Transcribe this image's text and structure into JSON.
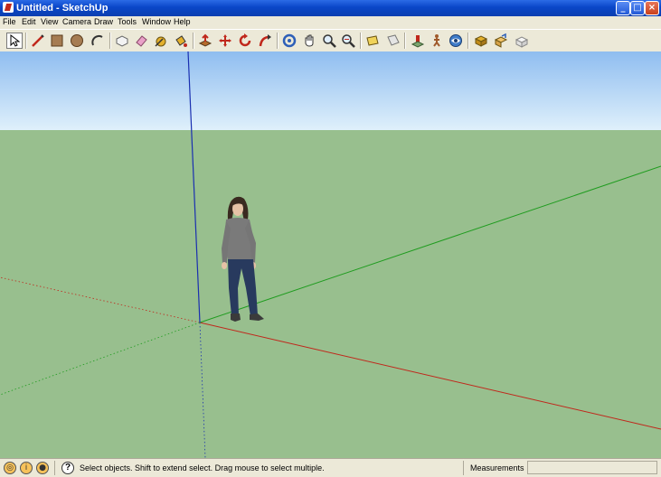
{
  "window": {
    "title": "Untitled - SketchUp",
    "minimize": "_",
    "maximize": "□",
    "close": "×"
  },
  "menu": [
    "File",
    "Edit",
    "View",
    "Camera",
    "Draw",
    "Tools",
    "Window",
    "Help"
  ],
  "toolbar": {
    "tools": [
      "select",
      "line",
      "rectangle",
      "circle",
      "arc",
      "make-component",
      "eraser",
      "tape-measure",
      "paint-bucket",
      "push-pull",
      "move",
      "rotate",
      "follow-me",
      "orbit",
      "pan",
      "zoom",
      "zoom-extents",
      "section-plane",
      "display-section-planes",
      "position-camera",
      "walk",
      "look-around",
      "get-models",
      "share-model",
      "make-3d-warehouse"
    ]
  },
  "colors": {
    "sky_top": "#8fbdf0",
    "sky_bottom": "#dff0fb",
    "ground": "#98bf8e",
    "axis_red": "#c0281c",
    "axis_green": "#1f9c1f",
    "axis_blue": "#1a2fb0"
  },
  "status": {
    "message": "Select objects. Shift to extend select. Drag mouse to select multiple.",
    "measurements_label": "Measurements",
    "measurements_value": ""
  }
}
